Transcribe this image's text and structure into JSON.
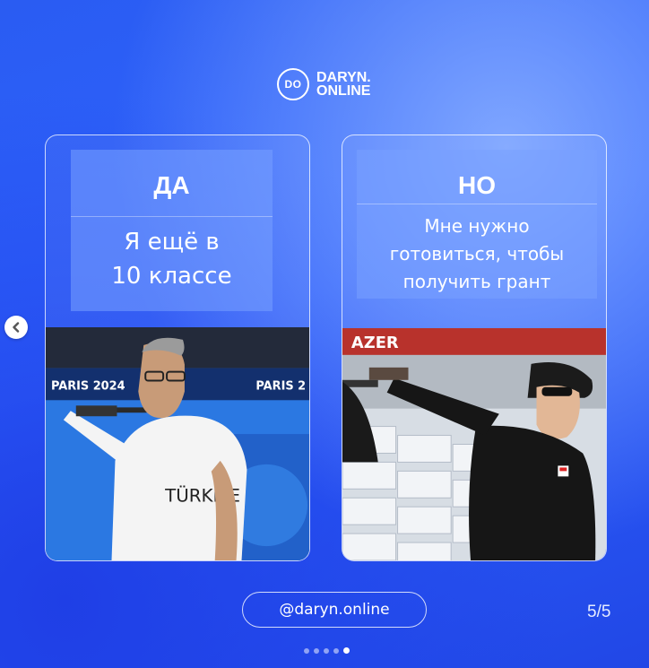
{
  "logo": {
    "mark": "DO",
    "line1": "DARYN.",
    "line2": "ONLINE"
  },
  "cards": [
    {
      "title": "ДА",
      "body": "Я ещё в\n10 классе",
      "photo_text": [
        "PARIS 2024",
        "PARIS 2"
      ]
    },
    {
      "title": "НО",
      "body": "Мне нужно\nготовиться, чтобы\nполучить грант",
      "photo_text": [
        "AZER"
      ]
    }
  ],
  "footer": {
    "handle": "@daryn.online",
    "page_counter": "5/5"
  },
  "carousel": {
    "total_dots": 5,
    "active_dot": 5
  },
  "colors": {
    "background": "#2f63ff",
    "panel": "#7aa0ff",
    "text": "#ffffff"
  },
  "icons": {
    "prev": "chevron-left-icon",
    "logo": "daryn-logo"
  }
}
